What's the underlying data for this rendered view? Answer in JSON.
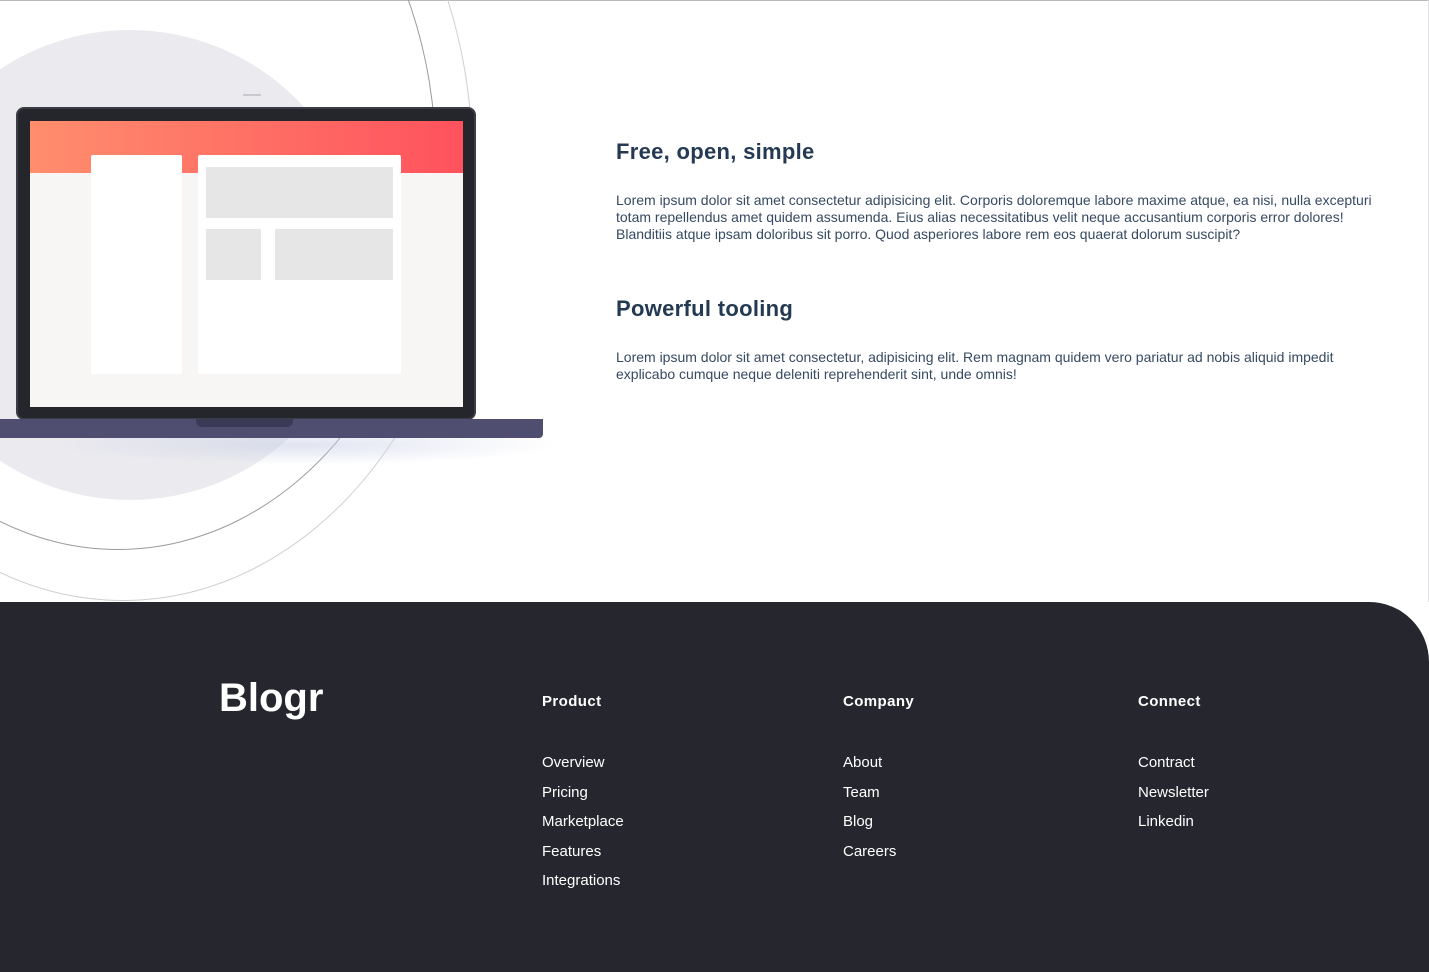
{
  "features": [
    {
      "title": "Free, open, simple",
      "text": "Lorem ipsum dolor sit amet consectetur adipisicing elit. Corporis doloremque labore maxime atque, ea nisi, nulla excepturi totam repellendus amet quidem assumenda. Eius alias necessitatibus velit neque accusantium corporis error dolores! Blanditiis atque ipsam doloribus sit porro. Quod asperiores labore rem eos quaerat dolorum suscipit?"
    },
    {
      "title": "Powerful tooling",
      "text": "Lorem ipsum dolor sit amet consectetur, adipisicing elit. Rem magnam quidem vero pariatur ad nobis aliquid impedit explicabo cumque neque deleniti reprehenderit sint, unde omnis!"
    }
  ],
  "illustration": {
    "icon": "laptop-illustration",
    "screen_gradient": [
      "#ff8e6d",
      "#ff525d"
    ],
    "base_color": "#4f4d70"
  },
  "footer": {
    "logo": "Blogr",
    "background": "#25262e",
    "columns": [
      {
        "heading": "Product",
        "links": [
          "Overview",
          "Pricing",
          "Marketplace",
          "Features",
          "Integrations"
        ]
      },
      {
        "heading": "Company",
        "links": [
          "About",
          "Team",
          "Blog",
          "Careers"
        ]
      },
      {
        "heading": "Connect",
        "links": [
          "Contract",
          "Newsletter",
          "Linkedin"
        ]
      }
    ]
  },
  "colors": {
    "heading": "#243a52",
    "body_text": "#364a62",
    "footer_text": "#ffffff"
  }
}
